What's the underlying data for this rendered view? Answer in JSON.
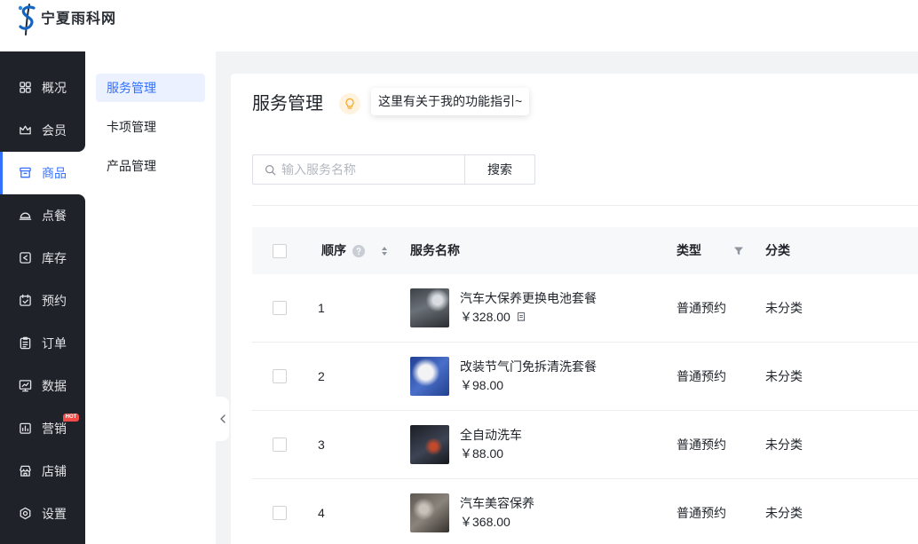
{
  "header": {
    "logo_icon": "brand-logo-icon",
    "logo_text": "宁夏雨科网"
  },
  "sidebar": {
    "items": [
      {
        "label": "概况",
        "icon": "dashboard-icon"
      },
      {
        "label": "会员",
        "icon": "crown-icon"
      },
      {
        "label": "商品",
        "icon": "shop-icon",
        "active": true
      },
      {
        "label": "点餐",
        "icon": "dish-cover-icon"
      },
      {
        "label": "库存",
        "icon": "inventory-icon"
      },
      {
        "label": "预约",
        "icon": "calendar-check-icon"
      },
      {
        "label": "订单",
        "icon": "order-list-icon"
      },
      {
        "label": "数据",
        "icon": "monitor-chart-icon"
      },
      {
        "label": "营销",
        "icon": "marketing-chart-icon",
        "badge": "HOT"
      },
      {
        "label": "店铺",
        "icon": "store-icon"
      },
      {
        "label": "设置",
        "icon": "settings-icon"
      }
    ]
  },
  "subnav": {
    "items": [
      {
        "label": "服务管理",
        "active": true
      },
      {
        "label": "卡项管理"
      },
      {
        "label": "产品管理"
      }
    ],
    "collapse_icon": "chevron-left-icon"
  },
  "page": {
    "title": "服务管理",
    "guide_icon": "bulb-icon",
    "guide_tip": "这里有关于我的功能指引~"
  },
  "search": {
    "icon": "search-icon",
    "placeholder": "输入服务名称",
    "button_label": "搜索"
  },
  "table": {
    "columns": {
      "order": "顺序",
      "name": "服务名称",
      "type": "类型",
      "category": "分类"
    },
    "column_icons": {
      "order": [
        "help-icon",
        "sort-icon"
      ],
      "type": [
        "filter-icon"
      ]
    },
    "rows": [
      {
        "order": "1",
        "name": "汽车大保养更换电池套餐",
        "price": "￥328.00",
        "price_icon": "receipt-icon",
        "type": "普通预约",
        "category": "未分类"
      },
      {
        "order": "2",
        "name": "改装节气门免拆清洗套餐",
        "price": "￥98.00",
        "type": "普通预约",
        "category": "未分类"
      },
      {
        "order": "3",
        "name": "全自动洗车",
        "price": "￥88.00",
        "type": "普通预约",
        "category": "未分类"
      },
      {
        "order": "4",
        "name": "汽车美容保养",
        "price": "￥368.00",
        "type": "普通预约",
        "category": "未分类"
      }
    ]
  },
  "colors": {
    "accent": "#3370ff",
    "sidebar_bg": "#1f2329",
    "hot_badge": "#f54a45",
    "guide_bulb": "#f5a623",
    "page_bg": "#f2f3f5"
  }
}
